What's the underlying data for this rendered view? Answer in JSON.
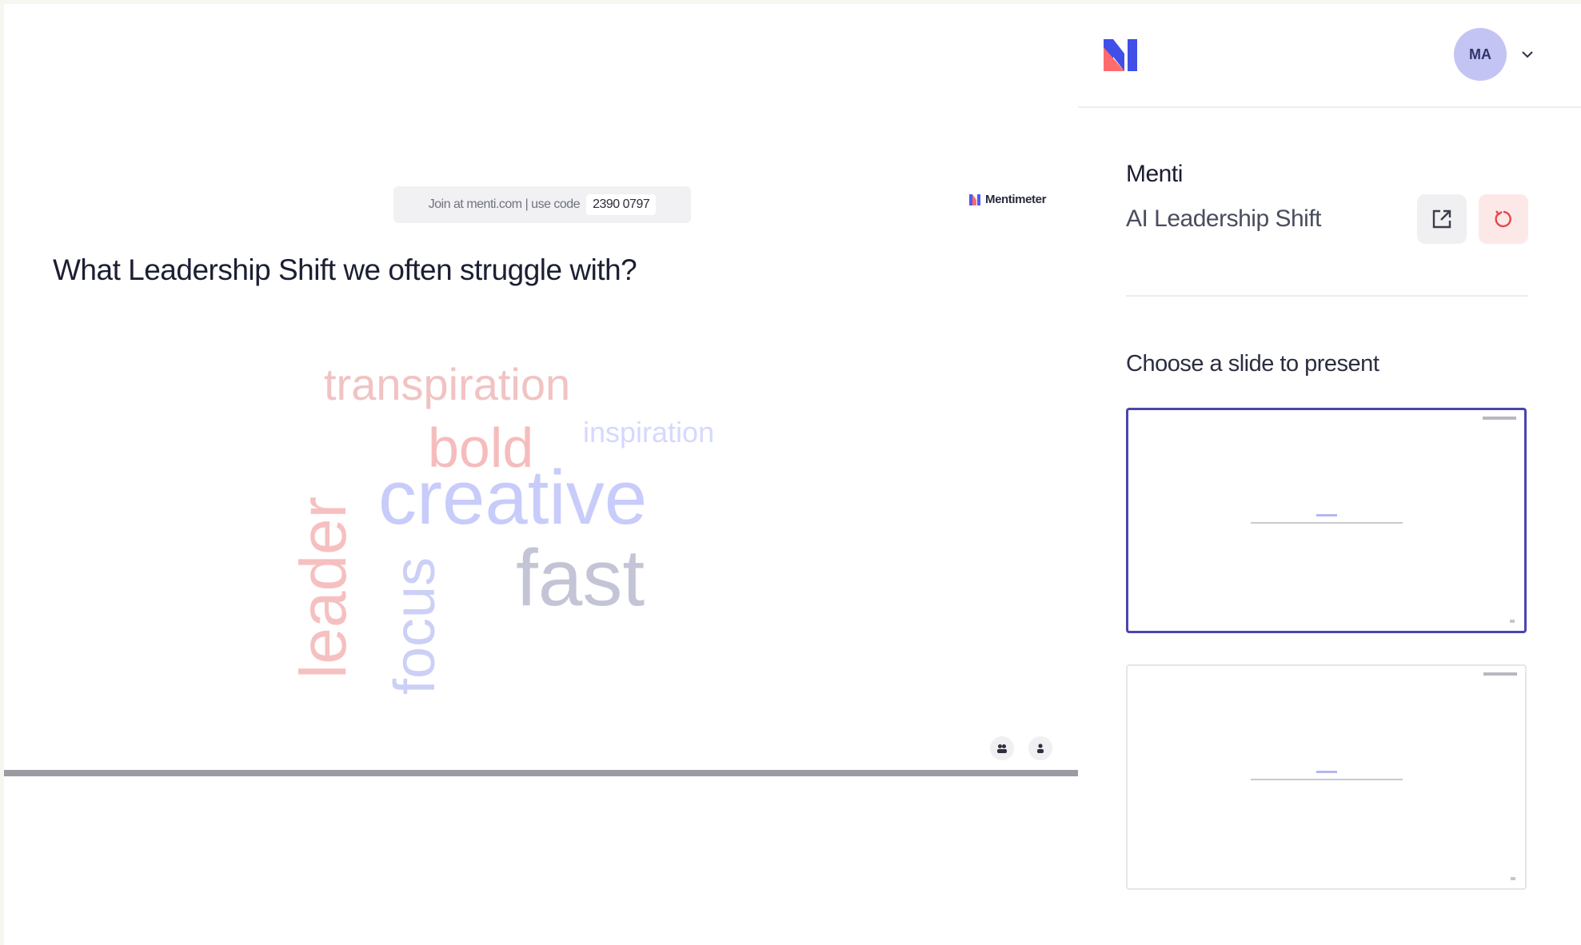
{
  "slide": {
    "join_prefix": "Join at menti.com | use code",
    "join_code": "2390 0797",
    "brand_label": "Mentimeter",
    "question": "What Leadership Shift we often struggle with?",
    "words": [
      {
        "text": "transpiration",
        "color": "#f1c3c3"
      },
      {
        "text": "bold",
        "color": "#f6bcbc"
      },
      {
        "text": "inspiration",
        "color": "#d5d8ff"
      },
      {
        "text": "creative",
        "color": "#c8ccfa"
      },
      {
        "text": "fast",
        "color": "#c3c5d6"
      },
      {
        "text": "leader",
        "color": "#f6c0c0"
      },
      {
        "text": "focus",
        "color": "#ccd0f6"
      }
    ],
    "progress_fraction": 1.0
  },
  "panel": {
    "avatar_initials": "MA",
    "owner": "Menti",
    "presentation_title": "AI Leadership Shift",
    "choose_label": "Choose a slide to present",
    "slides_count_visible": 2
  },
  "colors": {
    "accent": "#4a44b0",
    "logo_blue": "#4e5bf2",
    "logo_coral": "#ff6b6b",
    "avatar_bg": "#c3c4f4",
    "reset_bg": "#fde8e8"
  }
}
